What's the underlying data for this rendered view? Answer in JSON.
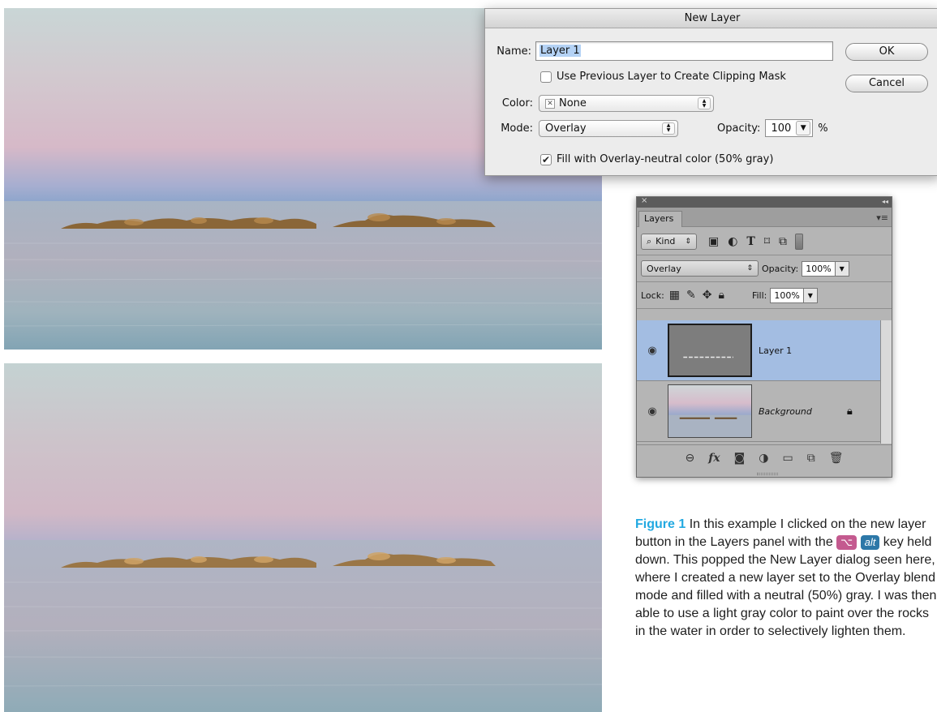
{
  "dialog": {
    "title": "New Layer",
    "name_label": "Name:",
    "name_value": "Layer 1",
    "clipping_label": "Use Previous Layer to Create Clipping Mask",
    "clipping_checked": false,
    "color_label": "Color:",
    "color_value": "None",
    "mode_label": "Mode:",
    "mode_value": "Overlay",
    "opacity_label": "Opacity:",
    "opacity_value": "100",
    "opacity_unit": "%",
    "fill_label": "Fill with Overlay-neutral color (50% gray)",
    "fill_checked": true,
    "ok_label": "OK",
    "cancel_label": "Cancel"
  },
  "panel": {
    "close_glyph": "×",
    "collapse_glyph": "◂◂",
    "tab_label": "Layers",
    "menu_glyph": "▾≡",
    "filter_kind": "Kind",
    "blend_mode": "Overlay",
    "opacity_label": "Opacity:",
    "opacity_value": "100%",
    "lock_label": "Lock:",
    "fill_label": "Fill:",
    "fill_value": "100%",
    "layers": [
      {
        "name": "Layer 1",
        "selected": true,
        "visible": true
      },
      {
        "name": "Background",
        "selected": false,
        "visible": true,
        "locked": true
      }
    ],
    "footer_icons": [
      "link-layers-icon",
      "fx-icon",
      "add-mask-icon",
      "adjustment-layer-icon",
      "new-group-icon",
      "new-layer-icon",
      "delete-layer-icon"
    ]
  },
  "caption": {
    "figure_label": "Figure 1",
    "part1": "In this example I clicked on the new layer button in the Layers panel with the",
    "mac_key": "⌥",
    "win_key": "alt",
    "part2": "key held down. This popped the New Layer dialog seen here, where I created a new layer set to the Overlay blend mode and filled with a neutral (50%) gray. I was then able to use a light gray color to paint over the rocks in the water in order to selectively lighten them."
  },
  "colors": {
    "accent_blue": "#22a9e1",
    "selected_layer": "#a3bde2",
    "mac_key_badge": "#c45a8f",
    "win_key_badge": "#2d78a8"
  }
}
